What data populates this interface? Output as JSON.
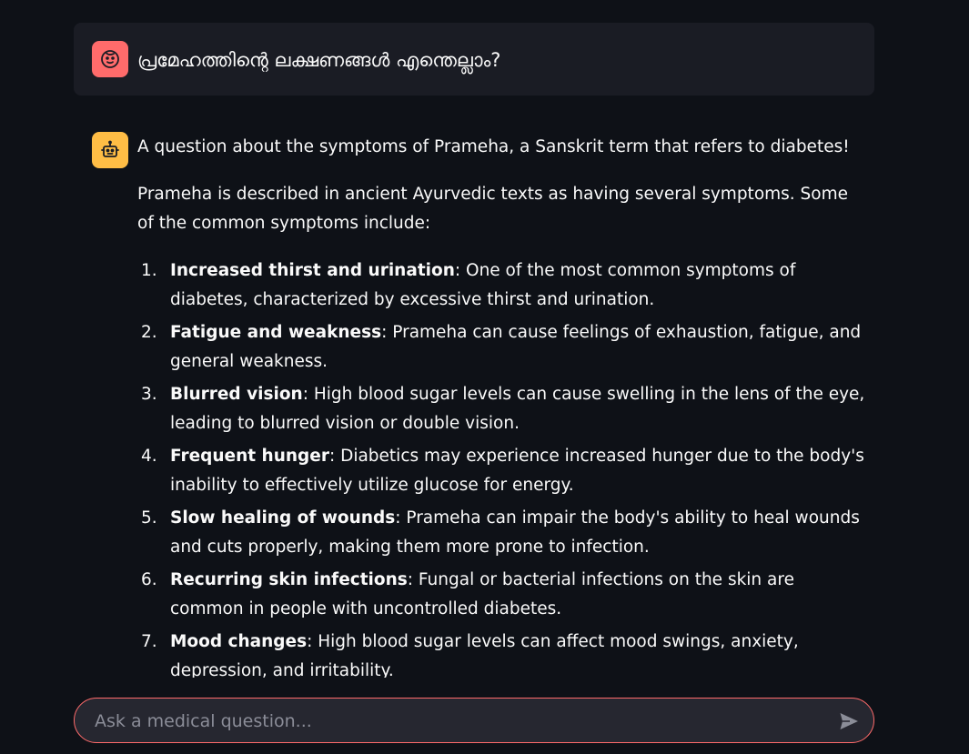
{
  "user_message": {
    "avatar_icon": "user-face-icon",
    "avatar_color": "#ff6b6b",
    "text": "പ്രമേഹത്തിന്റെ ലക്ഷണങ്ങൾ എന്തെല്ലാം?"
  },
  "assistant_message": {
    "avatar_icon": "robot-icon",
    "avatar_color": "#ffbd45",
    "intro": "A question about the symptoms of Prameha, a Sanskrit term that refers to diabetes!",
    "paragraph": "Prameha is described in ancient Ayurvedic texts as having several symptoms. Some of the common symptoms include:",
    "symptoms": [
      {
        "number": "1.",
        "title": "Increased thirst and urination",
        "text": ": One of the most common symptoms of diabetes, characterized by excessive thirst and urination."
      },
      {
        "number": "2.",
        "title": "Fatigue and weakness",
        "text": ": Prameha can cause feelings of exhaustion, fatigue, and general weakness."
      },
      {
        "number": "3.",
        "title": "Blurred vision",
        "text": ": High blood sugar levels can cause swelling in the lens of the eye, leading to blurred vision or double vision."
      },
      {
        "number": "4.",
        "title": "Frequent hunger",
        "text": ": Diabetics may experience increased hunger due to the body's inability to effectively utilize glucose for energy."
      },
      {
        "number": "5.",
        "title": "Slow healing of wounds",
        "text": ": Prameha can impair the body's ability to heal wounds and cuts properly, making them more prone to infection."
      },
      {
        "number": "6.",
        "title": "Recurring skin infections",
        "text": ": Fungal or bacterial infections on the skin are common in people with uncontrolled diabetes."
      },
      {
        "number": "7.",
        "title": "Mood changes",
        "text": ": High blood sugar levels can affect mood swings, anxiety, depression, and irritability."
      }
    ]
  },
  "chat_input": {
    "placeholder": "Ask a medical question...",
    "value": "",
    "border_color": "#ff6b6b",
    "send_icon": "send-icon"
  }
}
